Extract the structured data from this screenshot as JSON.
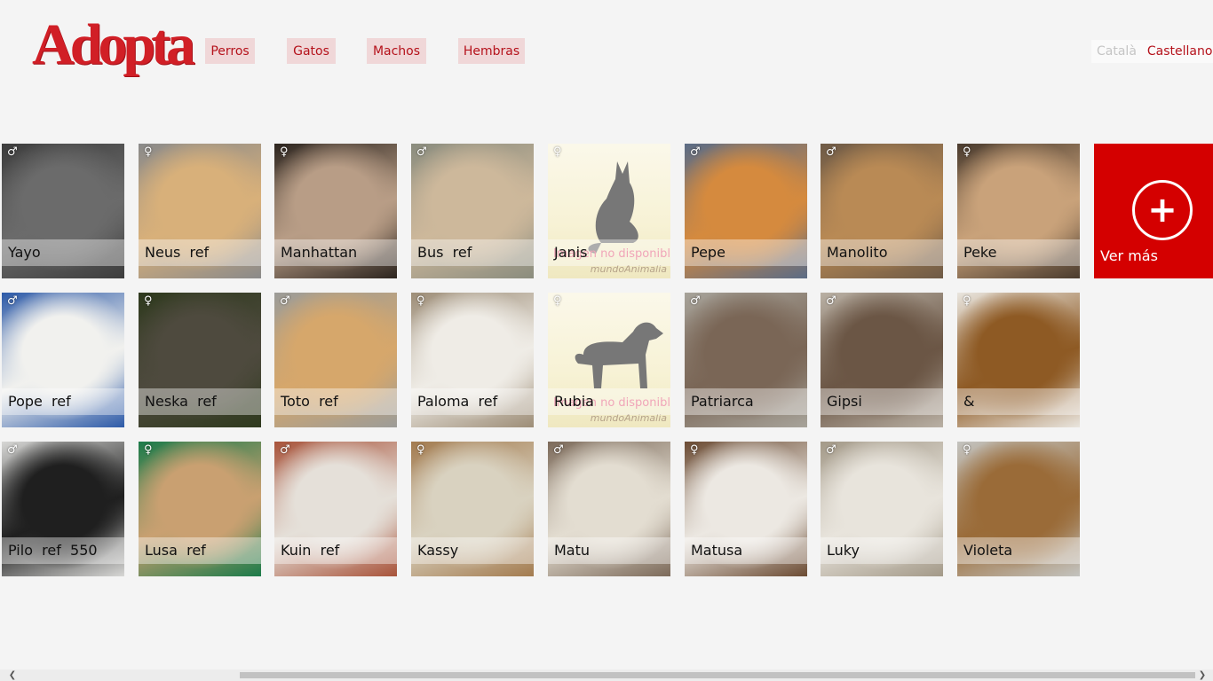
{
  "app": {
    "logo_text": "Adopta"
  },
  "nav": [
    {
      "label": "Perros"
    },
    {
      "label": "Gatos"
    },
    {
      "label": "Machos"
    },
    {
      "label": "Hembras"
    }
  ],
  "languages": {
    "catala": "Català",
    "castellano": "Castellano"
  },
  "no_image": {
    "text": "Imagen no disponible",
    "brand": "mundoAnimalia"
  },
  "pets": [
    {
      "name": "Yayo",
      "sex": "♂",
      "kind": "cat",
      "colors": [
        "#6b6b6b",
        "#3d3d3d"
      ]
    },
    {
      "name": "Neus  ref",
      "sex": "♀",
      "kind": "dog",
      "colors": [
        "#d8b07a",
        "#8a8a8a"
      ]
    },
    {
      "name": "Manhattan",
      "sex": "♀",
      "kind": "cat",
      "colors": [
        "#b89d86",
        "#2d251f"
      ]
    },
    {
      "name": "Bus  ref",
      "sex": "♂",
      "kind": "dog",
      "colors": [
        "#cdb89b",
        "#8a8c7e"
      ]
    },
    {
      "name": "Janis",
      "sex": "♀",
      "kind": "placeholder-cat",
      "colors": [
        "#f7f2d5",
        "#efe8c0"
      ]
    },
    {
      "name": "Pepe",
      "sex": "♂",
      "kind": "cat",
      "colors": [
        "#d58a3e",
        "#5b6c86"
      ]
    },
    {
      "name": "Manolito",
      "sex": "♂",
      "kind": "dog",
      "colors": [
        "#b98a55",
        "#6e5a46"
      ]
    },
    {
      "name": "Peke",
      "sex": "♀",
      "kind": "dog",
      "colors": [
        "#c9a27a",
        "#4a3b2e"
      ]
    },
    {
      "name": "Pope  ref",
      "sex": "♂",
      "kind": "dog",
      "colors": [
        "#f1f1ee",
        "#2d5aa8"
      ]
    },
    {
      "name": "Neska  ref",
      "sex": "♀",
      "kind": "cat",
      "colors": [
        "#4e4a3e",
        "#2f3a1e"
      ]
    },
    {
      "name": "Toto  ref",
      "sex": "♂",
      "kind": "dog",
      "colors": [
        "#d6a76b",
        "#9c9c98"
      ]
    },
    {
      "name": "Paloma  ref",
      "sex": "♀",
      "kind": "dog",
      "colors": [
        "#efece6",
        "#9d8d77"
      ]
    },
    {
      "name": "Rubia",
      "sex": "♀",
      "kind": "placeholder-dog",
      "colors": [
        "#f7f2d5",
        "#efe8c0"
      ]
    },
    {
      "name": "Patriarca",
      "sex": "♂",
      "kind": "dog",
      "colors": [
        "#7a6656",
        "#a7a39a"
      ]
    },
    {
      "name": "Gipsi",
      "sex": "♂",
      "kind": "dog",
      "colors": [
        "#6b5645",
        "#b9b0a4"
      ]
    },
    {
      "name": "&",
      "sex": "♀",
      "kind": "dog",
      "colors": [
        "#8e5a24",
        "#e9e5de"
      ]
    },
    {
      "name": "Pilo  ref  550",
      "sex": "♂",
      "kind": "dog",
      "colors": [
        "#1f1f1f",
        "#d7d7d5"
      ]
    },
    {
      "name": "Lusa  ref",
      "sex": "♀",
      "kind": "dog",
      "colors": [
        "#c9a071",
        "#1c7b4a"
      ]
    },
    {
      "name": "Kuin  ref",
      "sex": "♂",
      "kind": "dog",
      "colors": [
        "#e5e0d9",
        "#a8533a"
      ]
    },
    {
      "name": "Kassy",
      "sex": "♀",
      "kind": "cat",
      "colors": [
        "#d9d2c0",
        "#a37b4f"
      ]
    },
    {
      "name": "Matu",
      "sex": "♂",
      "kind": "dog",
      "colors": [
        "#e3ddd1",
        "#7c6a5a"
      ]
    },
    {
      "name": "Matusa",
      "sex": "♀",
      "kind": "dog",
      "colors": [
        "#ece8e2",
        "#6b4b33"
      ]
    },
    {
      "name": "Luky",
      "sex": "♂",
      "kind": "dog",
      "colors": [
        "#e8e4dc",
        "#a39988"
      ]
    },
    {
      "name": "Violeta",
      "sex": "♀",
      "kind": "dog",
      "colors": [
        "#9a6b38",
        "#c3c3bf"
      ]
    }
  ],
  "more": {
    "label": "Ver más",
    "icon": "plus-icon",
    "color": "#d40000"
  },
  "accent_color": "#d11f26"
}
